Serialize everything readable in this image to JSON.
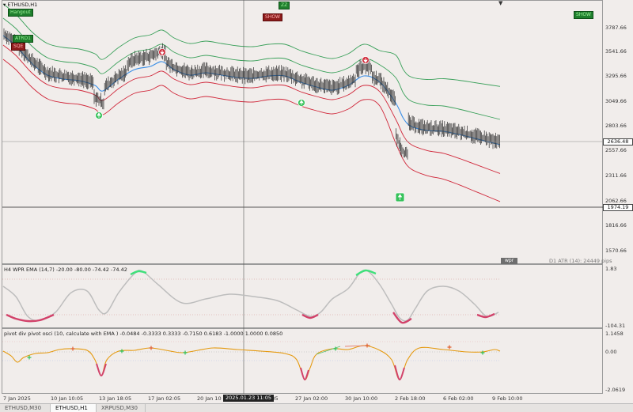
{
  "symbol_title": "ETHUSD,H1",
  "top_labels": {
    "left_top": "Hangout",
    "left_mid": "ATRD1",
    "left_red": "SQE",
    "center_green": "ZZ",
    "center_red": "SHOW",
    "right_green": "SHOW"
  },
  "price_axis": [
    "3787.66",
    "3541.66",
    "3295.66",
    "3049.66",
    "2803.66",
    "2557.66",
    "2311.66",
    "2062.66",
    "1816.66",
    "1570.66"
  ],
  "current_price": "2636.48",
  "crosshair_price": "1974.19",
  "atr_label": "D1 ATR (14): 24449 pips",
  "wpr_tag": "wpr",
  "wpr_title": "H4 WPR  EMA (14,7) -20.00 -80.00 -74.42 -74.42",
  "wpr_axis": {
    "top": "1.83",
    "bottom": "-104.31"
  },
  "pivot_title": "pivot div pivot osci (10, calculate with EMA ) -0.0484 -0.3333 0.3333 -0.7150 0.6183 -1.0000 1.0000 0.0850",
  "pivot_axis": {
    "top": "1.1458",
    "mid": "0.00",
    "bottom": "-2.0619"
  },
  "time_axis": [
    "7 Jan 2025",
    "10 Jan 10:05",
    "13 Jan 18:05",
    "17 Jan 02:05",
    "20 Jan 10",
    "8:05",
    "27 Jan 02:00",
    "30 Jan 10:00",
    "2 Feb 18:00",
    "6 Feb 02:00",
    "9 Feb 10:00"
  ],
  "crosshair_time": "2025.01.23 11:05",
  "tabs": [
    {
      "label": "ETHUSD,M30",
      "active": false
    },
    {
      "label": "ETHUSD,H1",
      "active": true
    },
    {
      "label": "XRPUSD,M30",
      "active": false
    }
  ],
  "colors": {
    "background": "#f1edeb",
    "candles": "#2a2a2a",
    "ma_blue": "#3a8ee6",
    "band_green": "#3aa05a",
    "band_red": "#d0273a",
    "wpr_line": "#bdbdbd",
    "wpr_high": "#3ee07a",
    "wpr_low": "#d2426a",
    "pivot_line": "#e59a10"
  }
}
